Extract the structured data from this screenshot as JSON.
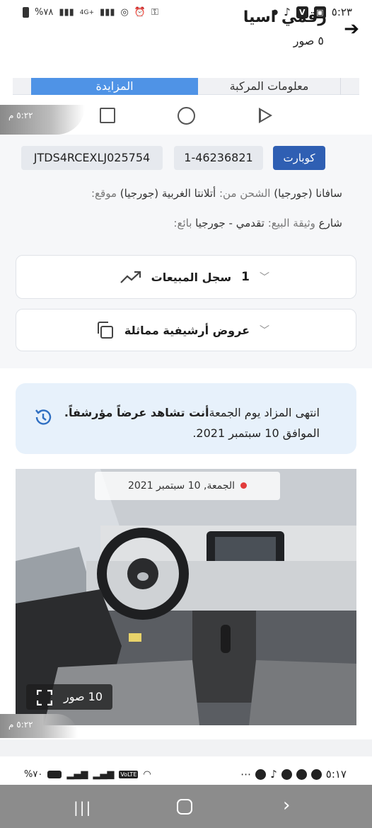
{
  "status_bar": {
    "time": "٥:٢٣",
    "battery": "%٧٨",
    "network": "4G+"
  },
  "header": {
    "title": "رقمي اسيا",
    "subtitle": "٥ صور"
  },
  "tabs": [
    {
      "label": "المزايدة",
      "active": true
    },
    {
      "label": "معلومات المركبة",
      "active": false
    }
  ],
  "screenshot_toolbar": {
    "time_top": "٥:٢٢ م",
    "time_bottom": "٥:٢٢ م"
  },
  "vehicle": {
    "vin": "JTDS4RCEXLJ025754",
    "lot": "1-46236821",
    "source": "كوبارت",
    "line1_location_label": "موقع:",
    "line1_location": "سافانا (جورجيا)",
    "line1_shipping_label": "الشحن من:",
    "line1_shipping": "أتلانتا الغربية (جورجيا)",
    "line2_seller_label": "بائع:",
    "line2_seller": "شارع",
    "line2_doc_label": "وثيقة البيع:",
    "line2_doc": "تقدمي - جورجيا"
  },
  "sales_history": {
    "count": "1",
    "label": "سجل المبيعات"
  },
  "archive": {
    "label": "عروض أرشيفية مماثلة"
  },
  "notice": {
    "text_start": "انتهى المزاد يوم الجمعة",
    "text_bold": "أنت تشاهد عرضاً مؤرشفاً.",
    "text_end": "الموافق 10 سبتمبر 2021."
  },
  "photo": {
    "date": "الجمعة, 10 سبتمبر 2021",
    "photos_count": "10 صور"
  },
  "status_bar_2": {
    "time": "٥:١٧",
    "battery": "%٧٠",
    "volte": "VoLTE"
  },
  "colors": {
    "tab_active": "#4f93e6",
    "copart": "#2f5fb3",
    "notice_bg": "#e7f1fb",
    "nav_bg": "#8c8c8c"
  }
}
